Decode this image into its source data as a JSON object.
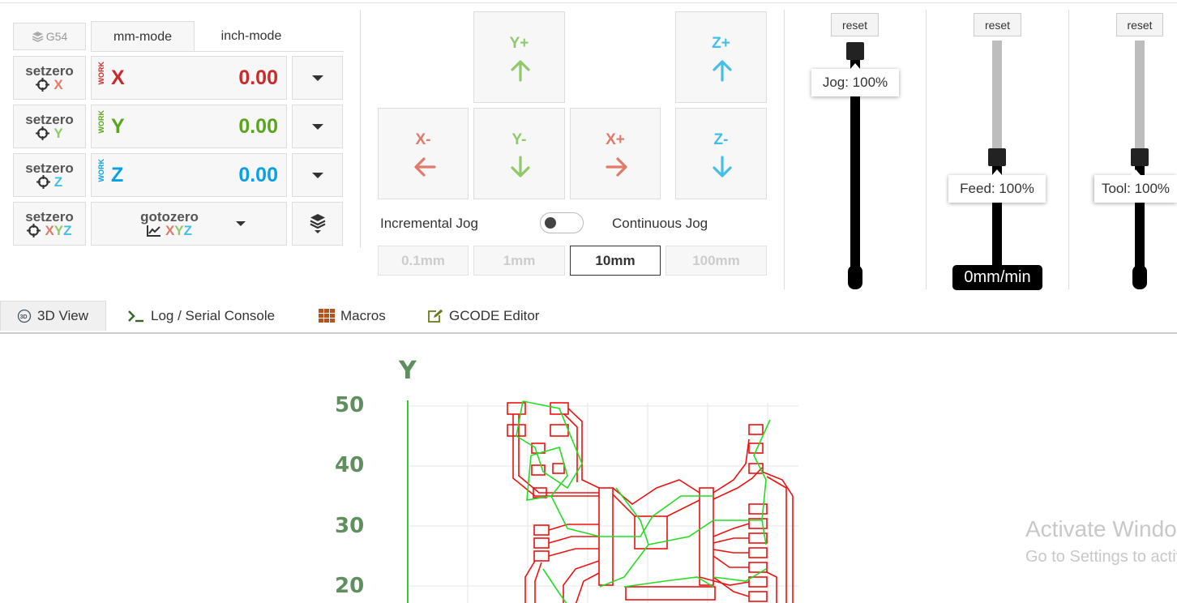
{
  "dro": {
    "wcs": "G54",
    "mode_tabs": [
      "mm-mode",
      "inch-mode"
    ],
    "work_label": "WORK",
    "setzero_label": "setzero",
    "goto_label": "gotozero",
    "axes": [
      {
        "name": "X",
        "value": "0.00",
        "color": "#cc2a2a"
      },
      {
        "name": "Y",
        "value": "0.00",
        "color": "#5aa51e"
      },
      {
        "name": "Z",
        "value": "0.00",
        "color": "#0aa0e8"
      }
    ],
    "xyz_letters": [
      "X",
      "Y",
      "Z"
    ]
  },
  "jog": {
    "buttons": {
      "yplus": "Y+",
      "zplus": "Z+",
      "xminus": "X-",
      "yminus": "Y-",
      "xplus": "X+",
      "zminus": "Z-"
    },
    "incremental_label": "Incremental Jog",
    "continuous_label": "Continuous Jog",
    "steps": [
      "0.1mm",
      "1mm",
      "10mm",
      "100mm"
    ],
    "active_step": "10mm",
    "colors": {
      "x": "#e07a6a",
      "y": "#8ec96a",
      "z": "#45bfe8"
    }
  },
  "overrides": {
    "reset_label": "reset",
    "jog": {
      "tooltip": "Jog: 100%",
      "value": 100
    },
    "feed": {
      "tooltip": "Feed: 100%",
      "value": 100,
      "readout": "0mm/min"
    },
    "tool": {
      "tooltip": "Tool: 100%",
      "value": 100
    }
  },
  "tabs": [
    "3D View",
    "Log / Serial Console",
    "Macros",
    "GCODE Editor"
  ],
  "viewer": {
    "axis_label": "Y",
    "y_ticks": [
      "50",
      "40",
      "30",
      "20"
    ],
    "watermark_line1": "Activate Windows",
    "watermark_line2": "Go to Settings to activate Windows."
  }
}
